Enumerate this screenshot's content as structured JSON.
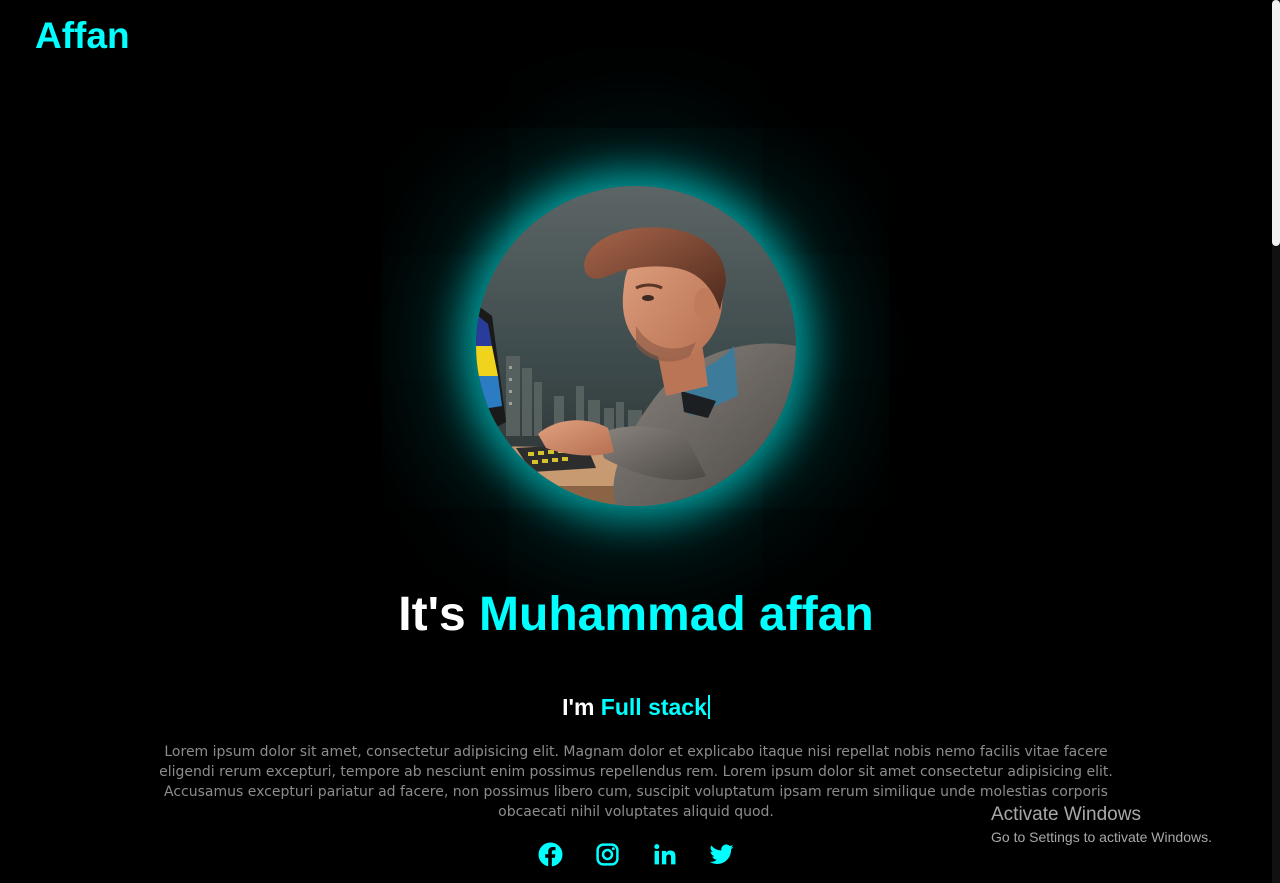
{
  "header": {
    "logo": "Affan"
  },
  "hero": {
    "headline_prefix": "It's ",
    "headline_name": "Muhammad affan",
    "subhead_prefix": "I'm ",
    "subhead_role": "Full stack",
    "bio": "Lorem ipsum dolor sit amet, consectetur adipisicing elit. Magnam dolor et explicabo itaque nisi repellat nobis nemo facilis vitae facere eligendi rerum excepturi, tempore ab nesciunt enim possimus repellendus rem. Lorem ipsum dolor sit amet consectetur adipisicing elit. Accusamus excepturi pariatur ad facere, non possimus libero cum, suscipit voluptatum ipsam rerum similique unde molestias corporis obcaecati nihil voluptates aliquid quod."
  },
  "socials": [
    {
      "icon": "facebook-icon"
    },
    {
      "icon": "instagram-icon"
    },
    {
      "icon": "linkedin-icon"
    },
    {
      "icon": "twitter-icon"
    }
  ],
  "watermark": {
    "title": "Activate Windows",
    "subtitle": "Go to Settings to activate Windows."
  },
  "colors": {
    "background": "#000000",
    "accent": "#00ffff",
    "text": "#ffffff",
    "muted": "#8c8c8c"
  }
}
